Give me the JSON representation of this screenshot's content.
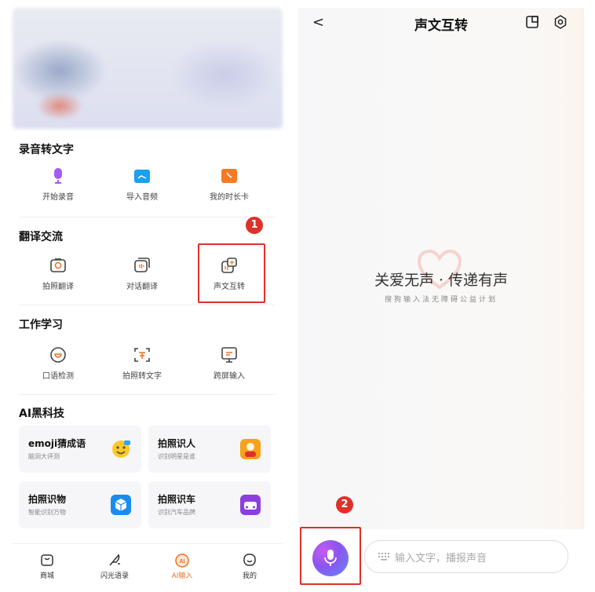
{
  "left": {
    "sections": [
      {
        "title": "录音转文字",
        "items": [
          "开始录音",
          "导入音频",
          "我的时长卡"
        ]
      },
      {
        "title": "翻译交流",
        "items": [
          "拍照翻译",
          "对话翻译",
          "声文互转"
        ]
      },
      {
        "title": "工作学习",
        "items": [
          "口语检测",
          "拍照转文字",
          "跨屏输入"
        ]
      }
    ],
    "ai": {
      "title": "AI黑科技",
      "cards": [
        {
          "title": "emoji猜成语",
          "sub": "脑洞大评测"
        },
        {
          "title": "拍照识人",
          "sub": "识别明星是谁"
        },
        {
          "title": "拍照识物",
          "sub": "智能识别万物"
        },
        {
          "title": "拍照识车",
          "sub": "识别汽车品牌"
        }
      ]
    },
    "tabs": [
      "商城",
      "闪光语录",
      "AI输入",
      "我的"
    ],
    "tab_icon_ai": "AI",
    "active_tab_color": "#f07020"
  },
  "badges": {
    "one": "1",
    "two": "2"
  },
  "right": {
    "back": "<",
    "title": "声文互转",
    "slogan": "关爱无声 · 传递有声",
    "slogan_sub": "搜狗输入法无障碍公益计划",
    "input_placeholder": "输入文字，播报声音"
  },
  "colors": {
    "highlight": "#e0302a",
    "accent": "#f07020"
  }
}
